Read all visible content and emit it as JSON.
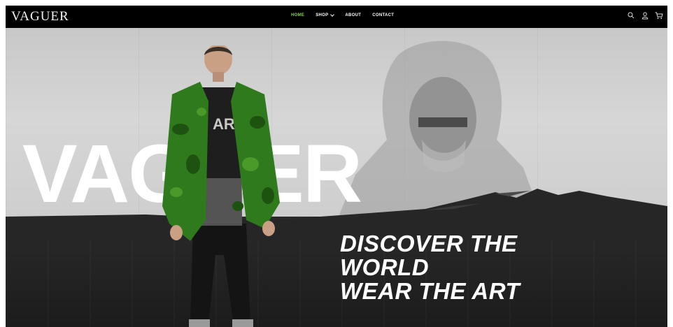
{
  "brand": {
    "logo": "VAGUER"
  },
  "nav": {
    "items": [
      {
        "label": "HOME",
        "active": true
      },
      {
        "label": "SHOP",
        "has_dropdown": true
      },
      {
        "label": "ABOUT"
      },
      {
        "label": "CONTACT"
      }
    ]
  },
  "icons": [
    "search-icon",
    "user-icon",
    "cart-icon"
  ],
  "hero": {
    "big_word": "VAGUER",
    "tagline": [
      "DISCOVER THE",
      "WORLD",
      "WEAR THE ART"
    ]
  },
  "colors": {
    "navbar": "#000000",
    "active_nav": "#7cd13f",
    "jacket": "#2f7a1c",
    "dark_band": "#1c1c1c"
  }
}
